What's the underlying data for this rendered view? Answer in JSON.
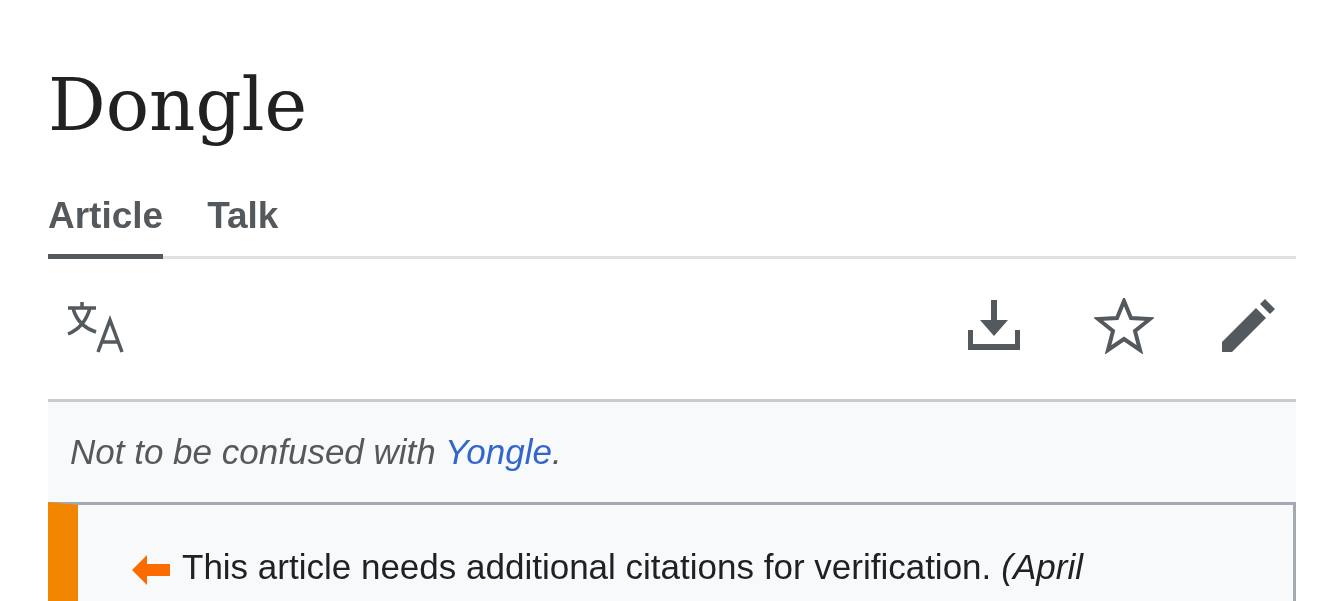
{
  "title": "Dongle",
  "tabs": [
    {
      "label": "Article",
      "selected": true
    },
    {
      "label": "Talk",
      "selected": false
    }
  ],
  "hatnote": {
    "before": "Not to be confused with ",
    "link": "Yongle",
    "after": "."
  },
  "notice": {
    "text": "This article needs additional citations for verification.",
    "date": "(April"
  }
}
